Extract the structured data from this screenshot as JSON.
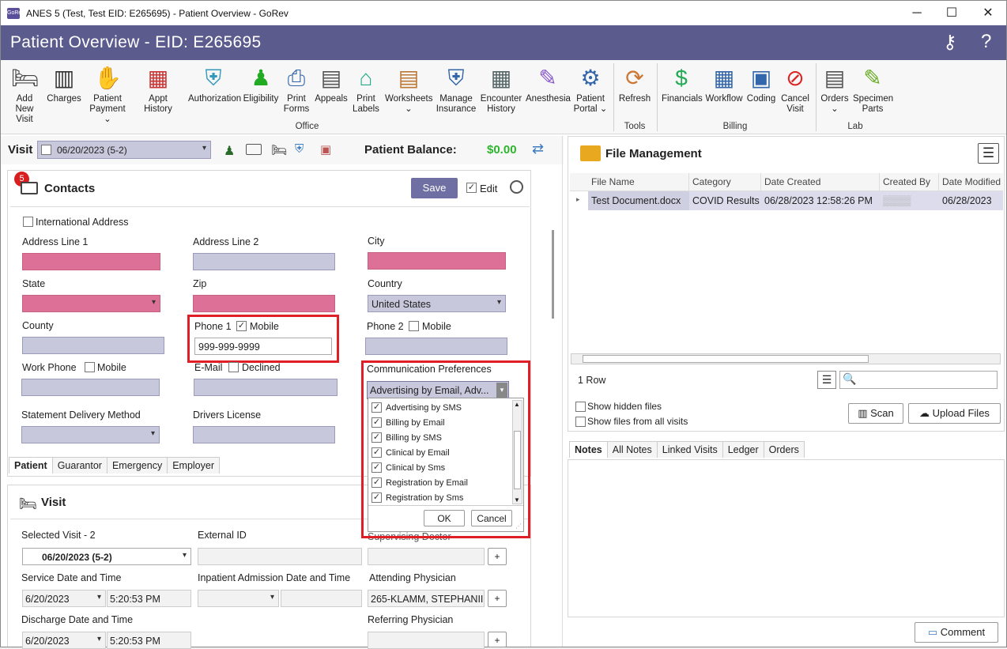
{
  "window": {
    "title": "ANES 5 (Test, Test EID: E265695) - Patient Overview - GoRev",
    "app_icon_text": "GoRev",
    "minimize": "─",
    "maximize": "☐",
    "close": "✕"
  },
  "header": {
    "title": "Patient Overview - EID: E265695",
    "help": "?"
  },
  "ribbon": {
    "buttons": [
      {
        "label": "Add New\nVisit"
      },
      {
        "label": "Charges"
      },
      {
        "label": "Patient\nPayment ⌄"
      },
      {
        "label": "Appt History"
      },
      {
        "label": "Authorization"
      },
      {
        "label": "Eligibility"
      },
      {
        "label": "Print\nForms"
      },
      {
        "label": "Appeals"
      },
      {
        "label": "Print\nLabels"
      },
      {
        "label": "Worksheets\n⌄"
      },
      {
        "label": "Manage\nInsurance"
      },
      {
        "label": "Encounter\nHistory"
      },
      {
        "label": "Anesthesia"
      },
      {
        "label": "Patient\nPortal ⌄"
      },
      {
        "label": "Refresh"
      },
      {
        "label": "Financials"
      },
      {
        "label": "Workflow"
      },
      {
        "label": "Coding"
      },
      {
        "label": "Cancel\nVisit"
      },
      {
        "label": "Orders\n⌄"
      },
      {
        "label": "Specimen\nParts"
      }
    ],
    "groups": {
      "office": "Office",
      "tools": "Tools",
      "billing": "Billing",
      "lab": "Lab"
    }
  },
  "visitbar": {
    "label": "Visit",
    "selected": "06/20/2023 (5-2)",
    "balance_label": "Patient Balance:",
    "balance_value": "$0.00"
  },
  "contacts": {
    "badge": "5",
    "title": "Contacts",
    "save": "Save",
    "edit": "Edit",
    "international": "International Address",
    "address1": "Address Line 1",
    "address2": "Address Line 2",
    "city": "City",
    "state": "State",
    "zip": "Zip",
    "country": "Country",
    "country_value": "United States",
    "county": "County",
    "phone1": "Phone 1",
    "phone1_mobile": "Mobile",
    "phone1_value": "999-999-9999",
    "phone2": "Phone 2",
    "phone2_mobile": "Mobile",
    "work_phone": "Work Phone",
    "work_mobile": "Mobile",
    "email": "E-Mail",
    "email_declined": "Declined",
    "comm_prefs": "Communication Preferences",
    "comm_value": "Advertising by Email, Adv...",
    "statement": "Statement Delivery Method",
    "drivers": "Drivers License",
    "tabs": [
      "Patient",
      "Guarantor",
      "Emergency",
      "Employer"
    ]
  },
  "comm_dropdown": {
    "items": [
      "Advertising by SMS",
      "Billing by Email",
      "Billing by SMS",
      "Clinical by Email",
      "Clinical by Sms",
      "Registration by Email",
      "Registration by Sms"
    ],
    "ok": "OK",
    "cancel": "Cancel"
  },
  "visit": {
    "title": "Visit",
    "selected_label": "Selected Visit - ",
    "selected_count": "2",
    "selected_value": "06/20/2023 (5-2)",
    "external_id": "External ID",
    "supervising": "Supervising Doctor",
    "service_dt": "Service Date and Time",
    "service_date": "6/20/2023",
    "service_time": "5:20:53 PM",
    "inpatient": "Inpatient Admission Date and Time",
    "attending": "Attending Physician",
    "attending_value": "265-KLAMM, STEPHANII",
    "discharge": "Discharge Date and Time",
    "discharge_date": "6/20/2023",
    "discharge_time": "5:20:53 PM",
    "referring": "Referring Physician",
    "plus": "+"
  },
  "files": {
    "title": "File Management",
    "columns": [
      "File Name",
      "Category",
      "Date Created",
      "Created By",
      "Date Modified"
    ],
    "row": {
      "name": "Test Document.docx",
      "category": "COVID Results",
      "created": "06/28/2023 12:58:26 PM",
      "created_by": "▒▒▒▒",
      "modified": "06/28/2023"
    },
    "rows_count": "1 Row",
    "show_hidden": "Show hidden files",
    "show_all": "Show files from all visits",
    "scan": "Scan",
    "upload": "Upload Files"
  },
  "notes": {
    "tabs": [
      "Notes",
      "All Notes",
      "Linked Visits",
      "Ledger",
      "Orders"
    ],
    "comment": "Comment"
  },
  "colors": {
    "header": "#5b5b8e",
    "required": "#dc7096",
    "field": "#c8c8dc",
    "highlight": "#e01e26",
    "balance": "#2db52d"
  }
}
